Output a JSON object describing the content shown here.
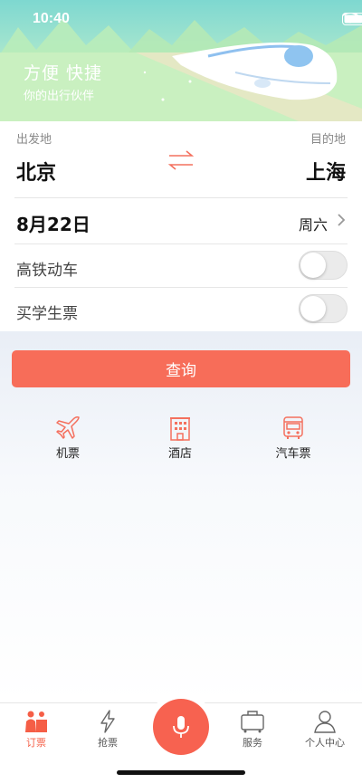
{
  "status": {
    "time": "10:40"
  },
  "banner": {
    "slogan": "方便  快捷",
    "subtitle": "你的出行伙伴"
  },
  "route": {
    "from_label": "出发地",
    "to_label": "目的地",
    "from_city": "北京",
    "to_city": "上海"
  },
  "date": {
    "date": "8月22日",
    "weekday": "周六"
  },
  "options": [
    {
      "label": "高铁动车",
      "enabled": false
    },
    {
      "label": "买学生票",
      "enabled": false
    }
  ],
  "query_button": "查询",
  "services": [
    {
      "label": "机票",
      "icon": "airplane-icon"
    },
    {
      "label": "酒店",
      "icon": "hotel-icon"
    },
    {
      "label": "汽车票",
      "icon": "bus-icon"
    }
  ],
  "tabs": [
    {
      "label": "订票",
      "icon": "booking-icon",
      "active": true
    },
    {
      "label": "抢票",
      "icon": "lightning-icon",
      "active": false
    },
    {
      "label": "",
      "icon": "microphone-icon",
      "active": false
    },
    {
      "label": "服务",
      "icon": "luggage-icon",
      "active": false
    },
    {
      "label": "个人中心",
      "icon": "person-icon",
      "active": false
    }
  ],
  "colors": {
    "accent": "#f76d59",
    "banner": "#9fe3cf"
  }
}
